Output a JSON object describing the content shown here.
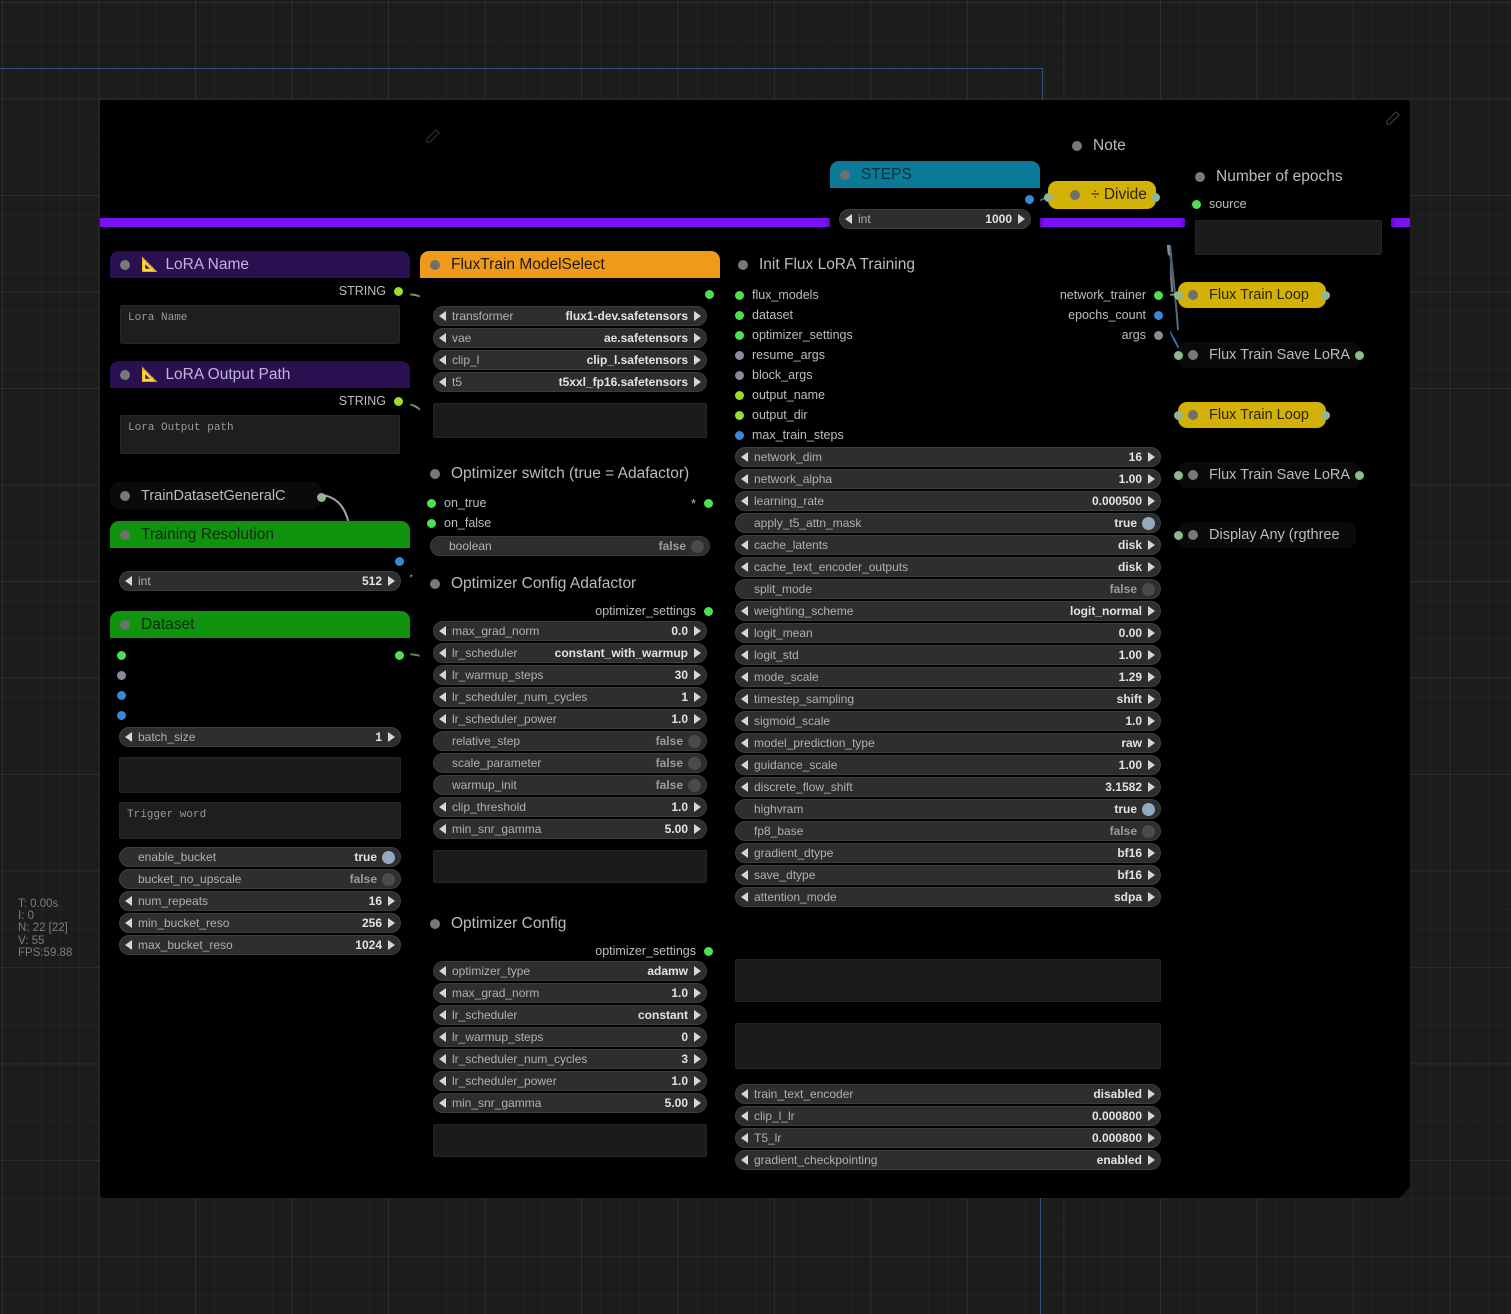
{
  "stats": {
    "time": "T: 0.00s",
    "iterations": "I: 0",
    "nodes": "N: 22 [22]",
    "version": "V: 55",
    "fps": "FPS:59.88"
  },
  "colors": {
    "group_bar": "#7a10f5",
    "header_purple": "#2a1050",
    "header_orange": "#f09a1a",
    "header_green": "#109410",
    "header_teal": "#0b7a99",
    "header_yellow": "#d4b106",
    "slot_green": "#4fe04f",
    "slot_blue": "#3a87d6",
    "slot_grey": "#8a8a9a",
    "selection": "#3a4f80"
  },
  "nodes": {
    "note_top": {
      "title": "",
      "pencil": "edit-pencil-icon"
    },
    "note_label": {
      "title": "Note"
    },
    "steps": {
      "title": "STEPS",
      "widgets": [
        {
          "name": "int",
          "value": "1000",
          "type": "number"
        }
      ]
    },
    "divide": {
      "title": "÷ Divide"
    },
    "number_of_epochs": {
      "title": "Number of epochs",
      "inputs": [
        {
          "label": "source",
          "color": "green"
        }
      ]
    },
    "lora_name": {
      "title": "LoRA Name",
      "emoji": "📐",
      "outputs": [
        {
          "label": "STRING",
          "color": "lgreen"
        }
      ],
      "textbox": "Lora Name"
    },
    "lora_output_path": {
      "title": "LoRA Output Path",
      "emoji": "📐",
      "outputs": [
        {
          "label": "STRING",
          "color": "lgreen"
        }
      ],
      "textbox": "Lora Output path"
    },
    "train_dataset_general": {
      "title": "TrainDatasetGeneralC"
    },
    "training_resolution": {
      "title": "Training Resolution",
      "widgets": [
        {
          "name": "int",
          "value": "512",
          "type": "number"
        }
      ]
    },
    "dataset": {
      "title": "Dataset",
      "widgets": [
        {
          "name": "batch_size",
          "value": "1",
          "type": "number"
        }
      ],
      "textbox_blank": "",
      "textbox": "Trigger word",
      "widgets2": [
        {
          "name": "enable_bucket",
          "value": "true",
          "type": "toggle_on"
        },
        {
          "name": "bucket_no_upscale",
          "value": "false",
          "type": "toggle_off"
        },
        {
          "name": "num_repeats",
          "value": "16",
          "type": "number"
        },
        {
          "name": "min_bucket_reso",
          "value": "256",
          "type": "number"
        },
        {
          "name": "max_bucket_reso",
          "value": "1024",
          "type": "number"
        }
      ]
    },
    "fluxtrain_modelselect": {
      "title": "FluxTrain ModelSelect",
      "widgets": [
        {
          "name": "transformer",
          "value": "flux1-dev.safetensors",
          "type": "combo"
        },
        {
          "name": "vae",
          "value": "ae.safetensors",
          "type": "combo"
        },
        {
          "name": "clip_l",
          "value": "clip_l.safetensors",
          "type": "combo"
        },
        {
          "name": "t5",
          "value": "t5xxl_fp16.safetensors",
          "type": "combo"
        }
      ]
    },
    "optimizer_switch": {
      "title": "Optimizer switch (true = Adafactor)",
      "inputs": [
        {
          "label": "on_true",
          "color": "green"
        },
        {
          "label": "on_false",
          "color": "green"
        }
      ],
      "output_star": "*",
      "widgets": [
        {
          "name": "boolean",
          "value": "false",
          "type": "toggle_off"
        }
      ]
    },
    "optimizer_config_adafactor": {
      "title": "Optimizer Config Adafactor",
      "outputs": [
        {
          "label": "optimizer_settings",
          "color": "green"
        }
      ],
      "widgets": [
        {
          "name": "max_grad_norm",
          "value": "0.0",
          "type": "number"
        },
        {
          "name": "lr_scheduler",
          "value": "constant_with_warmup",
          "type": "combo"
        },
        {
          "name": "lr_warmup_steps",
          "value": "30",
          "type": "number"
        },
        {
          "name": "lr_scheduler_num_cycles",
          "value": "1",
          "type": "number"
        },
        {
          "name": "lr_scheduler_power",
          "value": "1.0",
          "type": "number"
        },
        {
          "name": "relative_step",
          "value": "false",
          "type": "toggle_off"
        },
        {
          "name": "scale_parameter",
          "value": "false",
          "type": "toggle_off"
        },
        {
          "name": "warmup_init",
          "value": "false",
          "type": "toggle_off"
        },
        {
          "name": "clip_threshold",
          "value": "1.0",
          "type": "number"
        },
        {
          "name": "min_snr_gamma",
          "value": "5.00",
          "type": "number"
        }
      ]
    },
    "optimizer_config": {
      "title": "Optimizer Config",
      "outputs": [
        {
          "label": "optimizer_settings",
          "color": "green"
        }
      ],
      "widgets": [
        {
          "name": "optimizer_type",
          "value": "adamw",
          "type": "combo"
        },
        {
          "name": "max_grad_norm",
          "value": "1.0",
          "type": "number"
        },
        {
          "name": "lr_scheduler",
          "value": "constant",
          "type": "combo"
        },
        {
          "name": "lr_warmup_steps",
          "value": "0",
          "type": "number"
        },
        {
          "name": "lr_scheduler_num_cycles",
          "value": "3",
          "type": "number"
        },
        {
          "name": "lr_scheduler_power",
          "value": "1.0",
          "type": "number"
        },
        {
          "name": "min_snr_gamma",
          "value": "5.00",
          "type": "number"
        }
      ]
    },
    "init_flux_lora_training": {
      "title": "Init Flux LoRA Training",
      "inputs": [
        {
          "label": "flux_models",
          "color": "green"
        },
        {
          "label": "dataset",
          "color": "green"
        },
        {
          "label": "optimizer_settings",
          "color": "green"
        },
        {
          "label": "resume_args",
          "color": "grey"
        },
        {
          "label": "block_args",
          "color": "grey"
        },
        {
          "label": "output_name",
          "color": "lgreen"
        },
        {
          "label": "output_dir",
          "color": "lgreen"
        },
        {
          "label": "max_train_steps",
          "color": "blue"
        }
      ],
      "outputs": [
        {
          "label": "network_trainer",
          "color": "green"
        },
        {
          "label": "epochs_count",
          "color": "blue"
        },
        {
          "label": "args",
          "color": "grey"
        }
      ],
      "widgets": [
        {
          "name": "network_dim",
          "value": "16",
          "type": "number"
        },
        {
          "name": "network_alpha",
          "value": "1.00",
          "type": "number"
        },
        {
          "name": "learning_rate",
          "value": "0.000500",
          "type": "number"
        },
        {
          "name": "apply_t5_attn_mask",
          "value": "true",
          "type": "toggle_on"
        },
        {
          "name": "cache_latents",
          "value": "disk",
          "type": "combo"
        },
        {
          "name": "cache_text_encoder_outputs",
          "value": "disk",
          "type": "combo"
        },
        {
          "name": "split_mode",
          "value": "false",
          "type": "toggle_off"
        },
        {
          "name": "weighting_scheme",
          "value": "logit_normal",
          "type": "combo"
        },
        {
          "name": "logit_mean",
          "value": "0.00",
          "type": "number"
        },
        {
          "name": "logit_std",
          "value": "1.00",
          "type": "number"
        },
        {
          "name": "mode_scale",
          "value": "1.29",
          "type": "number"
        },
        {
          "name": "timestep_sampling",
          "value": "shift",
          "type": "combo"
        },
        {
          "name": "sigmoid_scale",
          "value": "1.0",
          "type": "number"
        },
        {
          "name": "model_prediction_type",
          "value": "raw",
          "type": "combo"
        },
        {
          "name": "guidance_scale",
          "value": "1.00",
          "type": "number"
        },
        {
          "name": "discrete_flow_shift",
          "value": "3.1582",
          "type": "number"
        },
        {
          "name": "highvram",
          "value": "true",
          "type": "toggle_on"
        },
        {
          "name": "fp8_base",
          "value": "false",
          "type": "toggle_off"
        },
        {
          "name": "gradient_dtype",
          "value": "bf16",
          "type": "combo"
        },
        {
          "name": "save_dtype",
          "value": "bf16",
          "type": "combo"
        },
        {
          "name": "attention_mode",
          "value": "sdpa",
          "type": "combo"
        }
      ],
      "widgets_tail": [
        {
          "name": "train_text_encoder",
          "value": "disabled",
          "type": "combo"
        },
        {
          "name": "clip_l_lr",
          "value": "0.000800",
          "type": "number"
        },
        {
          "name": "T5_lr",
          "value": "0.000800",
          "type": "number"
        },
        {
          "name": "gradient_checkpointing",
          "value": "enabled",
          "type": "combo"
        }
      ]
    },
    "collapsed_stack": [
      {
        "title": "Flux Train Loop",
        "style": "yellow"
      },
      {
        "title": "Flux Train Save LoRA",
        "style": "dark"
      },
      {
        "title": "Flux Train Loop",
        "style": "yellow"
      },
      {
        "title": "Flux Train Save LoRA",
        "style": "dark"
      },
      {
        "title": "Display Any (rgthree",
        "style": "dark"
      }
    ]
  }
}
